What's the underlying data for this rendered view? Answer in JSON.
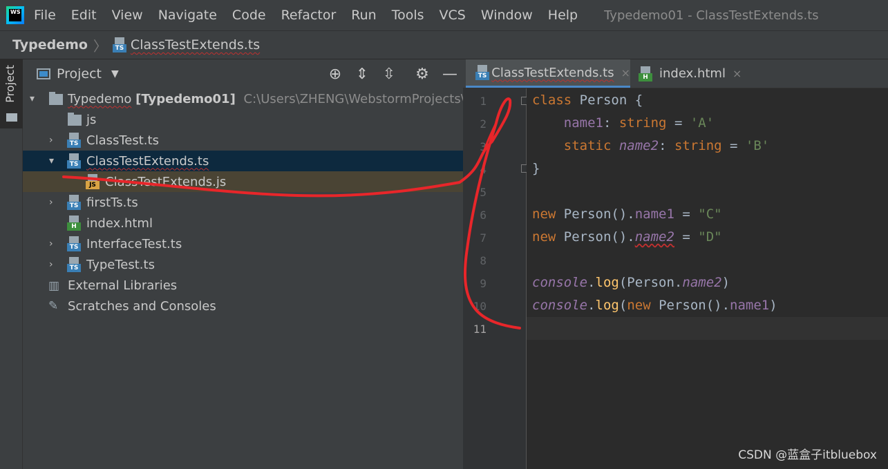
{
  "app": {
    "logo_text": "WS",
    "window_title": "Typedemo01 - ClassTestExtends.ts"
  },
  "menu": [
    "File",
    "Edit",
    "View",
    "Navigate",
    "Code",
    "Refactor",
    "Run",
    "Tools",
    "VCS",
    "Window",
    "Help"
  ],
  "breadcrumb": {
    "root": "Typedemo",
    "separator": "〉",
    "file": "ClassTestExtends.ts"
  },
  "left_strip": {
    "label": "Project"
  },
  "project_panel": {
    "title": "Project",
    "tree": [
      {
        "label": "Typedemo",
        "bold_label": "[Typedemo01]",
        "path": "C:\\Users\\ZHENG\\WebstormProjects\\Typ",
        "type": "folder",
        "expanded": true
      },
      {
        "label": "js",
        "type": "folder"
      },
      {
        "label": "ClassTest.ts",
        "type": "ts"
      },
      {
        "label": "ClassTestExtends.ts",
        "type": "ts",
        "expanded": true,
        "selected": true
      },
      {
        "label": "ClassTestExtends.js",
        "type": "js"
      },
      {
        "label": "firstTs.ts",
        "type": "ts"
      },
      {
        "label": "index.html",
        "type": "html"
      },
      {
        "label": "InterfaceTest.ts",
        "type": "ts"
      },
      {
        "label": "TypeTest.ts",
        "type": "ts"
      },
      {
        "label": "External Libraries",
        "type": "library"
      },
      {
        "label": "Scratches and Consoles",
        "type": "scratch"
      }
    ]
  },
  "editor": {
    "tabs": [
      {
        "label": "ClassTestExtends.ts",
        "close": "×",
        "active": true
      },
      {
        "label": "index.html",
        "close": "×",
        "active": false
      }
    ],
    "line_numbers": [
      "1",
      "2",
      "3",
      "4",
      "5",
      "6",
      "7",
      "8",
      "9",
      "10",
      "11"
    ],
    "current_line": "11"
  },
  "icon_labels": {
    "ts": "TS",
    "js": "JS",
    "html": "H"
  },
  "watermark": "CSDN @蓝盒子itbluebox",
  "colors": {
    "keyword": "#cc7832",
    "property": "#9876aa",
    "string": "#6a8759",
    "function": "#ffc66d",
    "annotation": "#e8262a",
    "selection": "#0d293e"
  }
}
